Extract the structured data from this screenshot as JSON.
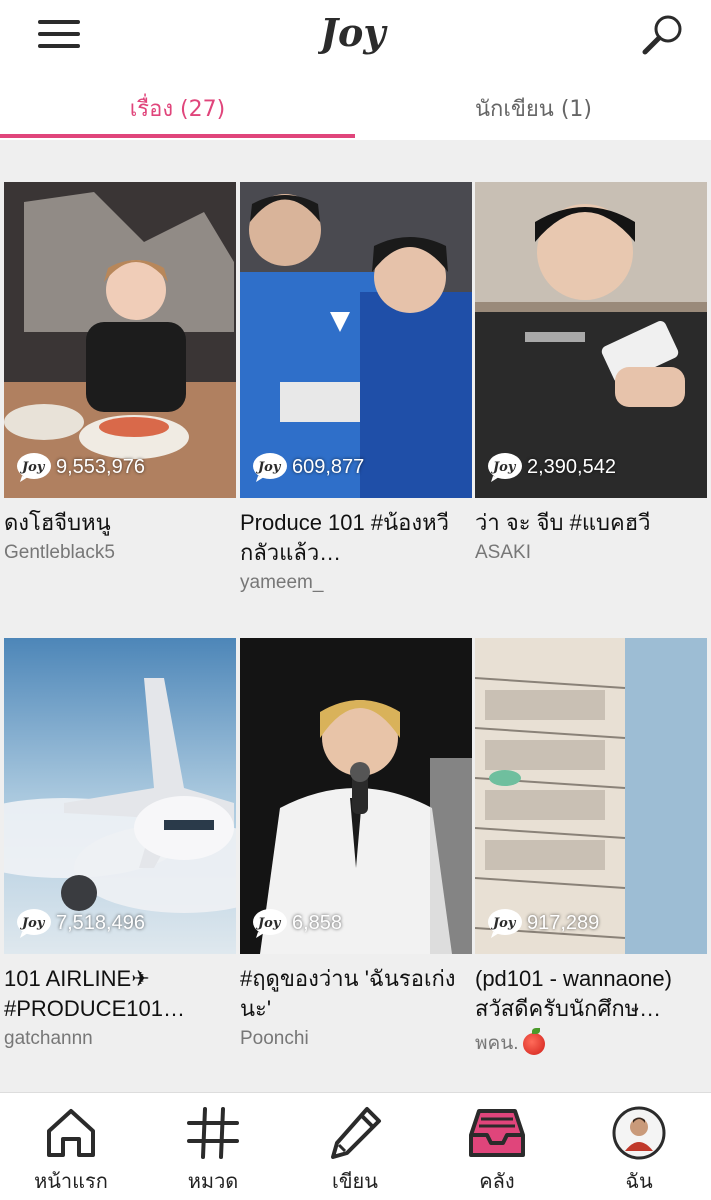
{
  "header": {
    "menu_icon": "hamburger-icon",
    "logo_text": "Joy",
    "search_icon": "search-icon"
  },
  "tabs": [
    {
      "label": "เรื่อง (27)",
      "active": true
    },
    {
      "label": "นักเขียน (1)",
      "active": false
    }
  ],
  "accent_color": "#e0457b",
  "stories": [
    {
      "views": "9,553,976",
      "title": "ดงโฮจีบหนู",
      "author": "Gentleblack5"
    },
    {
      "views": "609,877",
      "title": "Produce 101 #น้องหวีกลัวแล้ว…",
      "author": "yameem_"
    },
    {
      "views": "2,390,542",
      "title": "ว่า จะ จีบ #แบคฮวี",
      "author": "ASAKI"
    },
    {
      "views": "7,518,496",
      "title": "101 AIRLINE✈ #PRODUCE101…",
      "author": "gatchannn"
    },
    {
      "views": "6,858",
      "title": "#ฤดูของว่าน 'ฉันรอเก่งนะ'",
      "author": "Poonchi"
    },
    {
      "views": "917,289",
      "title": "(pd101 - wannaone) สวัสดีครับนักศึกษ…",
      "author": "พคน."
    }
  ],
  "bottom_nav": [
    {
      "label": "หน้าแรก",
      "icon": "home-icon"
    },
    {
      "label": "หมวด",
      "icon": "hashtag-icon"
    },
    {
      "label": "เขียน",
      "icon": "pencil-icon"
    },
    {
      "label": "คลัง",
      "icon": "library-tray-icon",
      "active": true
    },
    {
      "label": "ฉัน",
      "icon": "avatar"
    }
  ]
}
